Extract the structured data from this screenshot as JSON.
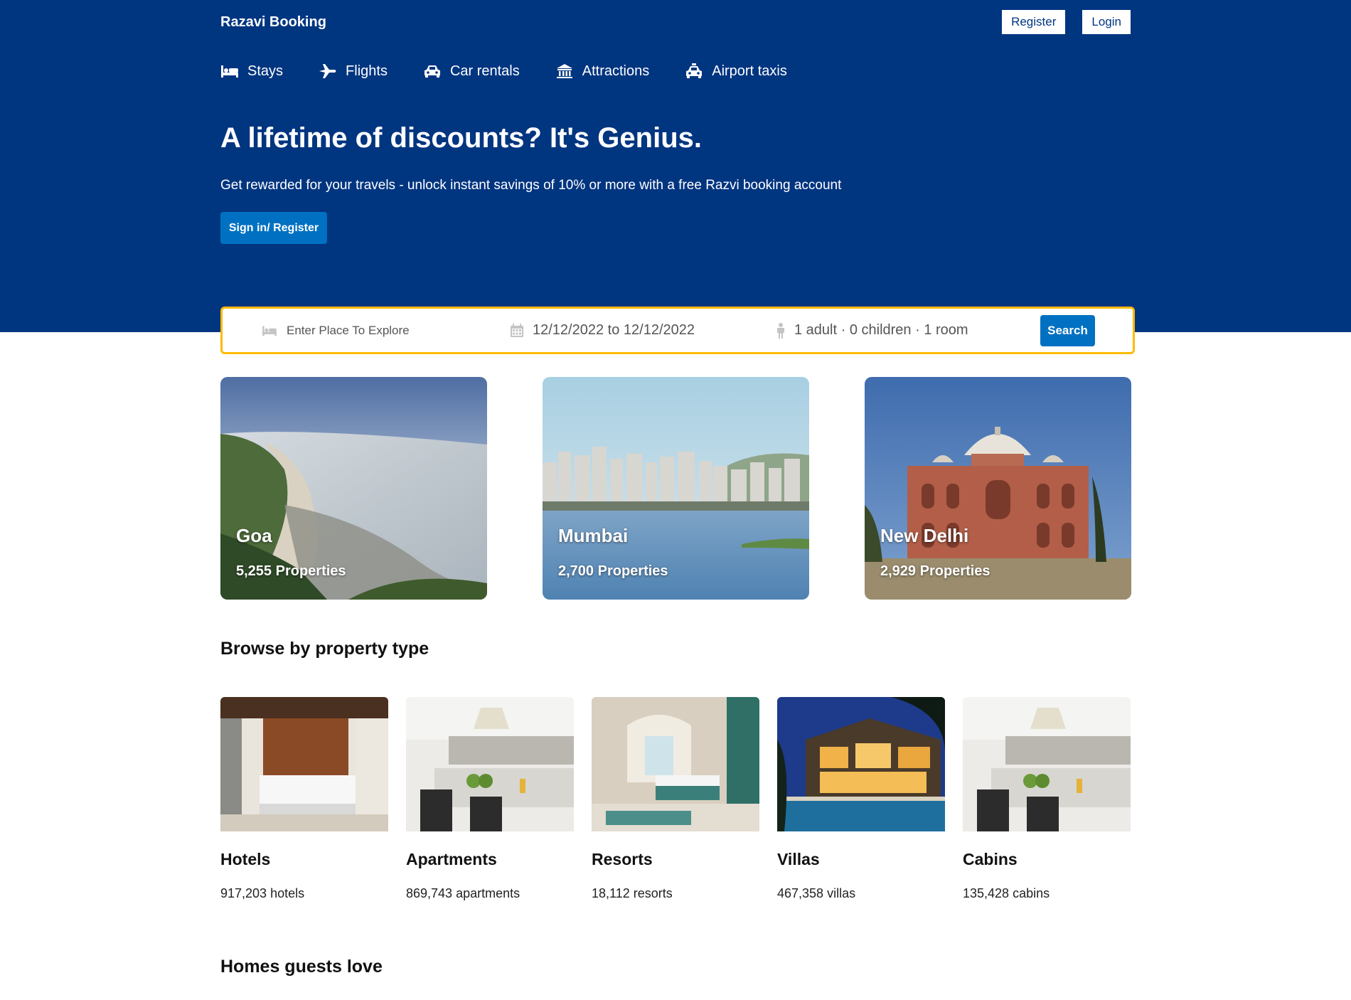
{
  "header": {
    "logo": "Razavi Booking",
    "register_label": "Register",
    "login_label": "Login"
  },
  "nav": {
    "items": [
      {
        "label": "Stays",
        "icon": "bed-icon"
      },
      {
        "label": "Flights",
        "icon": "plane-icon"
      },
      {
        "label": "Car rentals",
        "icon": "car-icon"
      },
      {
        "label": "Attractions",
        "icon": "landmark-icon"
      },
      {
        "label": "Airport taxis",
        "icon": "taxi-icon"
      }
    ]
  },
  "hero": {
    "title": "A lifetime of discounts? It's Genius.",
    "subtitle": "Get rewarded for your travels - unlock instant savings of 10% or more with a free Razvi booking account",
    "cta_label": "Sign in/ Register"
  },
  "search": {
    "destination_placeholder": "Enter Place To Explore",
    "dates_value": "12/12/2022 to 12/12/2022",
    "guests_value": "1 adult · 0 children · 1 room",
    "search_label": "Search"
  },
  "featured": [
    {
      "city": "Goa",
      "properties": "5,255 Properties"
    },
    {
      "city": "Mumbai",
      "properties": "2,700 Properties"
    },
    {
      "city": "New Delhi",
      "properties": "2,929 Properties"
    }
  ],
  "browse": {
    "title": "Browse by property type",
    "types": [
      {
        "name": "Hotels",
        "count": "917,203 hotels"
      },
      {
        "name": "Apartments",
        "count": "869,743 apartments"
      },
      {
        "name": "Resorts",
        "count": "18,112 resorts"
      },
      {
        "name": "Villas",
        "count": "467,358 villas"
      },
      {
        "name": "Cabins",
        "count": "135,428 cabins"
      }
    ]
  },
  "homes": {
    "title": "Homes guests love"
  },
  "colors": {
    "brand_blue": "#003580",
    "button_blue": "#0071c2",
    "search_border": "#febb02"
  }
}
